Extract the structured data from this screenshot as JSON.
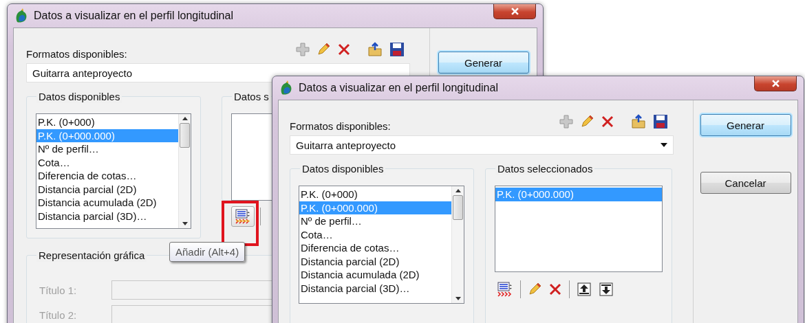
{
  "back_window": {
    "title": "Datos a visualizar en el perfil longitudinal",
    "formats_label": "Formatos disponibles:",
    "format_value": "Guitarra anteproyecto",
    "buttons": [
      {
        "label": "Generar",
        "default": true
      }
    ],
    "available": {
      "label": "Datos disponibles",
      "items": [
        {
          "label": "P.K. (0+000)",
          "selected": false
        },
        {
          "label": "P.K. (0+000.000)",
          "selected": true
        },
        {
          "label": "Nº de perfil…",
          "selected": false
        },
        {
          "label": "Cota…",
          "selected": false
        },
        {
          "label": "Diferencia de cotas…",
          "selected": false
        },
        {
          "label": "Distancia parcial (2D)",
          "selected": false
        },
        {
          "label": "Distancia acumulada (2D)",
          "selected": false
        },
        {
          "label": "Distancia parcial (3D)…",
          "selected": false
        }
      ]
    },
    "selected_label": "Datos s",
    "add_tool": {
      "highlighted": true,
      "tooltip": "Añadir (Alt+4)"
    },
    "graphic": {
      "label": "Representación gráfica",
      "fields": [
        {
          "label": "Título 1:",
          "disabled": true
        },
        {
          "label": "Título 2:",
          "disabled": true
        }
      ]
    }
  },
  "front_window": {
    "title": "Datos a visualizar en el perfil longitudinal",
    "formats_label": "Formatos disponibles:",
    "format_value": "Guitarra anteproyecto",
    "buttons": [
      {
        "label": "Generar",
        "default": true
      },
      {
        "label": "Cancelar",
        "default": false
      }
    ],
    "available": {
      "label": "Datos disponibles",
      "items": [
        {
          "label": "P.K. (0+000)",
          "selected": false
        },
        {
          "label": "P.K. (0+000.000)",
          "selected": true
        },
        {
          "label": "Nº de perfil…",
          "selected": false
        },
        {
          "label": "Cota…",
          "selected": false
        },
        {
          "label": "Diferencia de cotas…",
          "selected": false
        },
        {
          "label": "Distancia parcial (2D)",
          "selected": false
        },
        {
          "label": "Distancia acumulada (2D)",
          "selected": false
        },
        {
          "label": "Distancia parcial (3D)…",
          "selected": false
        }
      ]
    },
    "selected": {
      "label": "Datos seleccionados",
      "items": [
        {
          "label": "P.K. (0+000.000)",
          "selected": true
        }
      ]
    }
  }
}
